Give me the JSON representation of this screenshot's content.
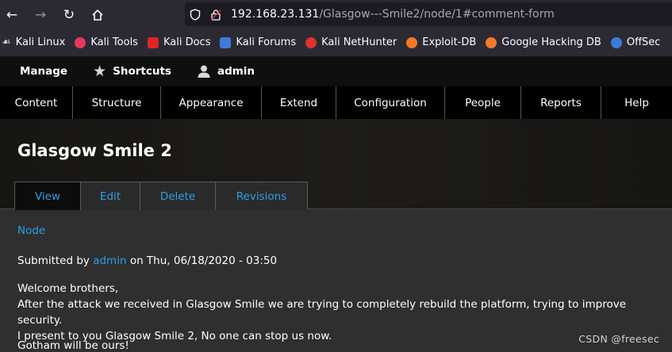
{
  "browser": {
    "url_host": "192.168.23.131",
    "url_path": "/Glasgow---Smile2/node/1#comment-form"
  },
  "bookmarks": [
    {
      "label": "Kali Linux",
      "icon": "kali-dragon-icon",
      "color": "#cfcfcf"
    },
    {
      "label": "Kali Tools",
      "icon": "kali-tools-icon",
      "color": "#e8375c"
    },
    {
      "label": "Kali Docs",
      "icon": "kali-docs-icon",
      "color": "#e02424"
    },
    {
      "label": "Kali Forums",
      "icon": "kali-forums-icon",
      "color": "#3d7bd9"
    },
    {
      "label": "Kali NetHunter",
      "icon": "nethunter-icon",
      "color": "#e03131"
    },
    {
      "label": "Exploit-DB",
      "icon": "exploit-db-icon",
      "color": "#f07a2a"
    },
    {
      "label": "Google Hacking DB",
      "icon": "ghdb-icon",
      "color": "#f07a2a"
    },
    {
      "label": "OffSec",
      "icon": "offsec-icon",
      "color": "#3d7bd9"
    }
  ],
  "toolbar": {
    "manage": "Manage",
    "shortcuts": "Shortcuts",
    "user": "admin"
  },
  "menu": [
    "Content",
    "Structure",
    "Appearance",
    "Extend",
    "Configuration",
    "People",
    "Reports",
    "Help"
  ],
  "page": {
    "title": "Glasgow Smile 2",
    "tabs": [
      "View",
      "Edit",
      "Delete",
      "Revisions"
    ]
  },
  "content": {
    "breadcrumb": "Node",
    "submitted_prefix": "Submitted by",
    "author": "admin",
    "submitted_suffix": "on Thu, 06/18/2020 - 03:50",
    "lines": [
      "Welcome brothers,",
      "After the attack we received in Glasgow Smile we are trying to completely rebuild the platform, trying to improve security.",
      "I present to you Glasgow Smile 2, No one can stop us now."
    ],
    "closing": "Gotham will be ours!"
  },
  "watermark": "CSDN @freesec",
  "colors": {
    "link": "#2e9fe6",
    "toolbar": "#0f0f0f"
  }
}
